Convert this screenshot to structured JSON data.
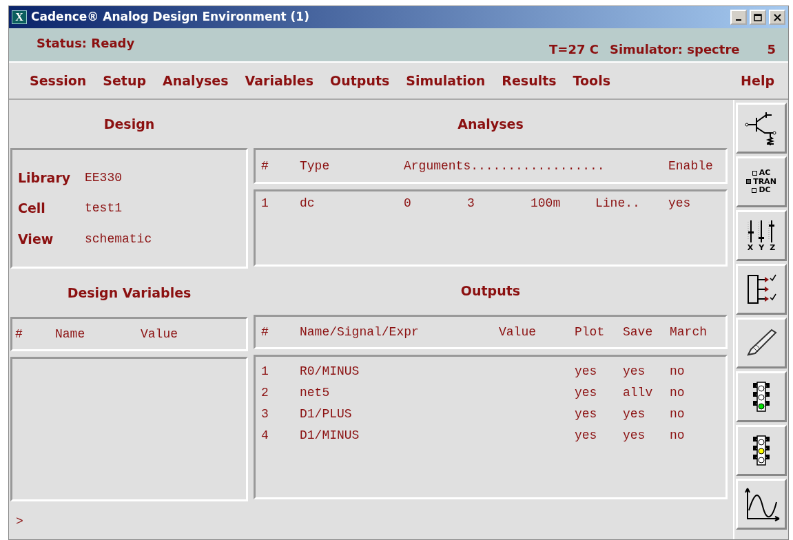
{
  "window": {
    "title": "Cadence® Analog Design Environment (1)",
    "app_icon": "X"
  },
  "status_bar": {
    "status": "Status: Ready",
    "temperature": "T=27 C",
    "simulator": "Simulator: spectre",
    "number": "5"
  },
  "menu": [
    "Session",
    "Setup",
    "Analyses",
    "Variables",
    "Outputs",
    "Simulation",
    "Results",
    "Tools"
  ],
  "help_menu": "Help",
  "design": {
    "heading": "Design",
    "fields": [
      {
        "label": "Library",
        "value": "EE330"
      },
      {
        "label": "Cell",
        "value": "test1"
      },
      {
        "label": "View",
        "value": "schematic"
      }
    ]
  },
  "analyses": {
    "heading": "Analyses",
    "columns": [
      "#",
      "Type",
      "Arguments..................",
      "Enable"
    ],
    "rows": [
      {
        "num": "1",
        "type": "dc",
        "arguments": [
          "0",
          "3",
          "100m",
          "Line.."
        ],
        "enable": "yes"
      }
    ]
  },
  "design_variables": {
    "heading": "Design Variables",
    "columns": [
      "#",
      "Name",
      "Value"
    ]
  },
  "outputs": {
    "heading": "Outputs",
    "columns": [
      "#",
      "Name/Signal/Expr",
      "Value",
      "Plot",
      "Save",
      "March"
    ],
    "rows": [
      {
        "num": "1",
        "name": "R0/MINUS",
        "plot": "yes",
        "save": "yes",
        "march": "no"
      },
      {
        "num": "2",
        "name": "net5",
        "plot": "yes",
        "save": "allv",
        "march": "no"
      },
      {
        "num": "3",
        "name": "D1/PLUS",
        "plot": "yes",
        "save": "yes",
        "march": "no"
      },
      {
        "num": "4",
        "name": "D1/MINUS",
        "plot": "yes",
        "save": "yes",
        "march": "no"
      }
    ]
  },
  "prompt": ">",
  "toolbar": [
    {
      "kind": "transistor"
    },
    {
      "kind": "choice",
      "options": [
        {
          "label": "AC",
          "selected": false
        },
        {
          "label": "TRAN",
          "selected": true
        },
        {
          "label": "DC",
          "selected": false
        }
      ]
    },
    {
      "kind": "sliders",
      "labels": [
        "X",
        "Y",
        "Z"
      ]
    },
    {
      "kind": "outputs"
    },
    {
      "kind": "pen"
    },
    {
      "kind": "green_light"
    },
    {
      "kind": "yellow_light"
    },
    {
      "kind": "waveform"
    }
  ]
}
